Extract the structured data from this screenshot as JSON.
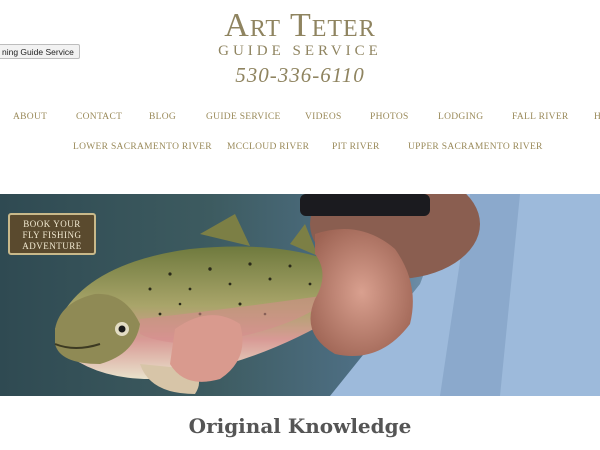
{
  "tooltip": "ning Guide Service",
  "logo": {
    "title": "Art Teter",
    "subtitle": "GUIDE SERVICE",
    "phone": "530-336-6110"
  },
  "nav": {
    "row1": [
      "ABOUT",
      "CONTACT",
      "BLOG",
      "GUIDE SERVICE",
      "VIDEOS",
      "PHOTOS",
      "LODGING",
      "FALL RIVER",
      "H"
    ],
    "row2": [
      "LOWER SACRAMENTO RIVER",
      "MCCLOUD RIVER",
      "PIT RIVER",
      "UPPER SACRAMENTO RIVER"
    ]
  },
  "hero": {
    "button_lines": [
      "BOOK YOUR",
      "FLY FISHING",
      "ADVENTURE"
    ]
  },
  "main": {
    "heading": "Original Knowledge"
  },
  "colors": {
    "logo": "#8f8460",
    "nav": "#9a8a5a",
    "heading": "#555555"
  }
}
